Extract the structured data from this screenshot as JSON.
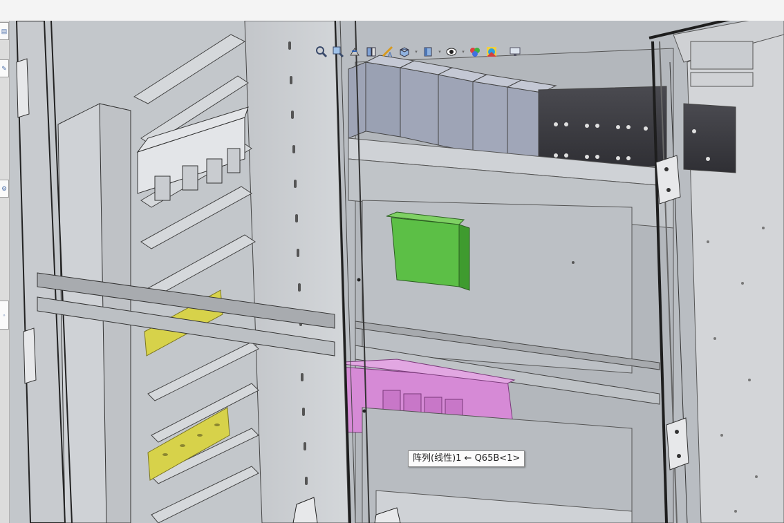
{
  "window": {
    "background_color": "#f3f3f3"
  },
  "hud_toolbar": {
    "buttons": [
      {
        "icon": "zoom-to-fit-icon"
      },
      {
        "icon": "zoom-to-area-icon"
      },
      {
        "icon": "previous-view-icon"
      },
      {
        "icon": "section-view-icon"
      },
      {
        "icon": "dynamic-annotation-icon"
      },
      {
        "icon": "view-orientation-icon",
        "has_dropdown": true
      },
      {
        "icon": "display-style-icon",
        "has_dropdown": true
      },
      {
        "icon": "hide-show-items-icon",
        "has_dropdown": true
      },
      {
        "icon": "edit-appearance-icon"
      },
      {
        "icon": "apply-scene-icon"
      },
      {
        "icon": "view-settings-icon"
      }
    ]
  },
  "model": {
    "components": [
      {
        "name": "cabinet-door",
        "color": "#c8cbcf"
      },
      {
        "name": "terminal-blocks",
        "color": "#9fa6b8"
      },
      {
        "name": "contactors",
        "color": "#3f3f44"
      },
      {
        "name": "green-module",
        "color": "#4fb33c"
      },
      {
        "name": "purple-highlighted-component",
        "color": "#d68ad6"
      },
      {
        "name": "din-rail-yellow",
        "color": "#d7d24a"
      }
    ]
  },
  "tooltip": {
    "text": "阵列(线性)1 ← Q65B<1>"
  },
  "left_strip": {
    "tab_icons": [
      "feature-tree-tab-icon",
      "property-tab-icon",
      "config-tab-icon"
    ]
  }
}
